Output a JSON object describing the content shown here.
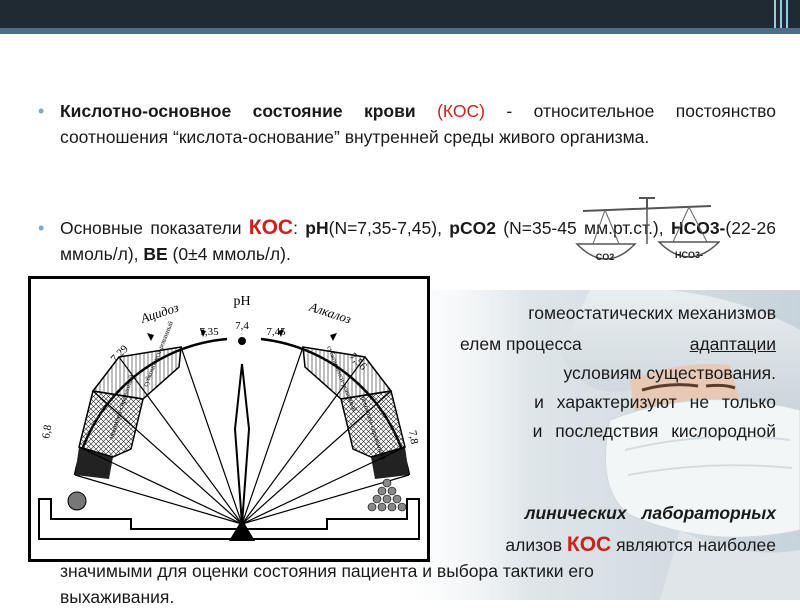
{
  "p1": {
    "title": "Кислотно-основное состояние крови",
    "abbr": "(КОС)",
    "rest": " - относительное постоянство соотношения “кислота-основание” внутренней среды живого организма."
  },
  "p2": {
    "pre": "Основные показатели ",
    "kos": "КОС",
    "colon": ": ",
    "ph": "pH",
    "ph_v": "(N=7,35-7,45), ",
    "pco2": "pCO2",
    "pco2_v": " (N=35-45 мм.рт.ст.), ",
    "hco3": "HCO3-",
    "hco3_v": "(22-26 ммоль/л), ",
    "be": "BE",
    "be_v": " (0±4 ммоль/л)."
  },
  "p3": {
    "a": "гомеостатических механизмов",
    "b": "елем процесса",
    "b_u": "адаптации",
    "c": "условиям существования.",
    "d": "и характеризуют не только",
    "e": "и последствия кислородной"
  },
  "p4": {
    "a": "линических лабораторных",
    "b": "ализов",
    "kos": "КОС",
    "b2": " являются наиболее",
    "c": "значимыми для оценки состояния пациента и выбора тактики его",
    "d": "выхаживания."
  },
  "balance": {
    "left": "CO2",
    "right": "HCO3-"
  },
  "gauge": {
    "ph": "pH",
    "acidosis": "Ацидоз",
    "alkalosis": "Алкалоз",
    "ticks": [
      "6,8",
      "7,29",
      "7,35",
      "7,4",
      "7,45",
      "7,56",
      "7,8"
    ],
    "zones_left": [
      "субкомпенси-рованный",
      "некомпен-сированный"
    ],
    "zones_right": [
      "субкомпенси-рованный",
      "некомпен-сированный"
    ]
  }
}
